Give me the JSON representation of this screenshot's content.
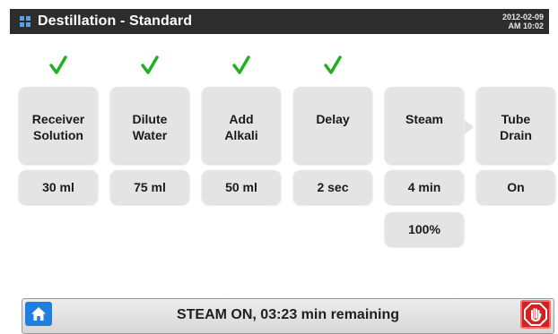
{
  "header": {
    "title": "Destillation - Standard",
    "date": "2012-02-09",
    "time": "AM 10:02"
  },
  "steps": [
    {
      "label_line1": "Receiver",
      "label_line2": "Solution",
      "value": "30 ml",
      "checked": true
    },
    {
      "label_line1": "Dilute",
      "label_line2": "Water",
      "value": "75 ml",
      "checked": true
    },
    {
      "label_line1": "Add",
      "label_line2": "Alkali",
      "value": "50 ml",
      "checked": true
    },
    {
      "label_line1": "Delay",
      "label_line2": "",
      "value": "2 sec",
      "checked": true
    },
    {
      "label_line1": "Steam",
      "label_line2": "",
      "value": "4 min",
      "extra_value": "100%",
      "checked": false,
      "active": true
    },
    {
      "label_line1": "Tube",
      "label_line2": "Drain",
      "value": "On",
      "checked": false
    }
  ],
  "status": {
    "text": "STEAM ON, 03:23 min remaining"
  },
  "icons": {
    "title": "grid-icon",
    "check": "checkmark-icon",
    "home": "home-icon",
    "stop": "stop-hand-icon",
    "flow": "arrow-right-icon"
  },
  "colors": {
    "title_bar": "#2d2d2d",
    "check": "#22b022",
    "home": "#1f7fe0",
    "stop": "#d42020"
  }
}
